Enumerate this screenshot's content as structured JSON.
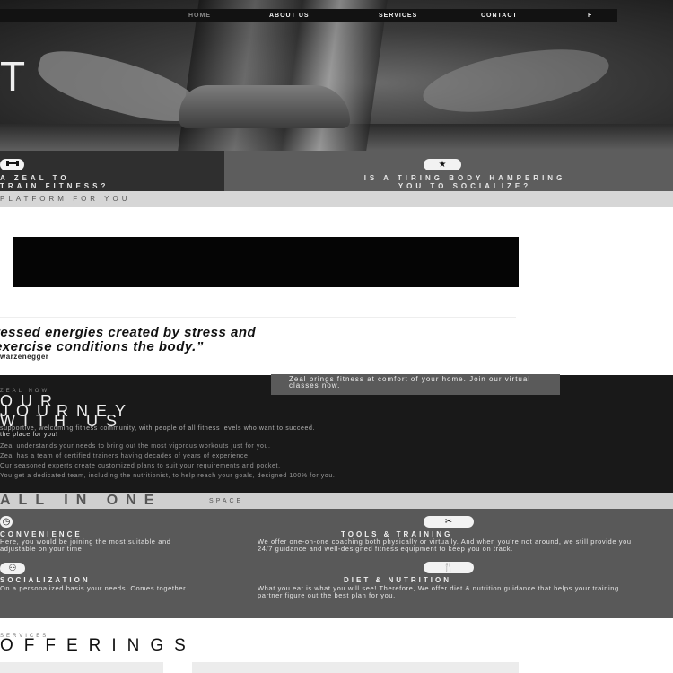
{
  "nav": {
    "items": [
      "HOME",
      "ABOUT US",
      "SERVICES",
      "CONTACT"
    ],
    "social_icon": "f"
  },
  "hero": {
    "letter": "T"
  },
  "features_strip": {
    "left_text": "A ZEAL TO\nTRAIN FITNESS?",
    "right_text": "IS A TIRING BODY HAMPERING\nYOU TO SOCIALIZE?",
    "left_icon": "dumbbell-icon",
    "right_icon": "star-icon"
  },
  "platform_band": "PLATFORM FOR YOU",
  "quote": {
    "text": "ressed energies created by stress and exercise conditions the body.”",
    "line1": "ressed energies created by stress and",
    "line2": "exercise conditions the body.”",
    "author": "warzenegger"
  },
  "journey": {
    "overlay": "Zeal brings fitness at comfort of your home. Join our virtual classes now.",
    "kicker": "ZEAL NOW",
    "heading": [
      "OUR",
      "JOURNEY",
      "WITH US"
    ],
    "lines": [
      "supportive, welcoming fitness community, with people of all fitness levels who want to succeed.",
      "the place for you!",
      "Zeal understands your needs to bring out the most vigorous workouts just for you.",
      "Zeal has a team of certified trainers having decades of years of experience.",
      "Our seasoned experts create customized plans to suit your requirements and pocket.",
      "You get a dedicated team, including the nutritionist, to help reach your goals, designed 100% for you."
    ]
  },
  "all_in_one": {
    "big": "ALL IN ONE",
    "small": "SPACE"
  },
  "features": [
    {
      "title": "CONVENIENCE",
      "desc": "Here, you would be joining the most suitable and adjustable on your time.",
      "icon": "clock-icon"
    },
    {
      "title": "TOOLS & TRAINING",
      "desc": "We offer one-on-one coaching both physically or virtually. And when you're not around, we still provide you 24/7 guidance and well-designed fitness equipment to keep you on track.",
      "icon": "tools-icon"
    },
    {
      "title": "SOCIALIZATION",
      "desc": "On a personalized basis your needs. Comes together.",
      "icon": "group-icon"
    },
    {
      "title": "DIET & NUTRITION",
      "desc": "What you eat is what you will see! Therefore, We offer diet & nutrition guidance that helps your training partner figure out the best plan for you.",
      "icon": "cutlery-icon"
    }
  ],
  "offerings": {
    "kicker": "SERVICES",
    "title": "OFFERINGS"
  }
}
